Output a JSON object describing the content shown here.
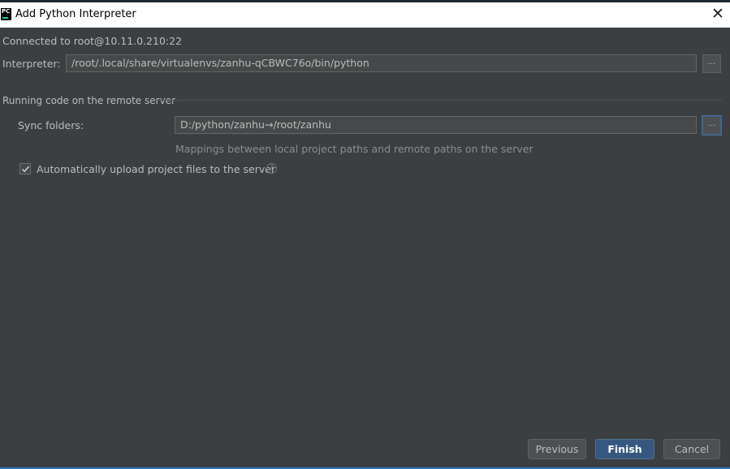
{
  "window": {
    "title": "Add Python Interpreter",
    "app_icon_text": "PC",
    "close_glyph": "✕"
  },
  "connection": {
    "text": "Connected to root@10.11.0.210:22"
  },
  "interpreter": {
    "label": "Interpreter:",
    "value": "/root/.local/share/virtualenvs/zanhu-qCBWC76o/bin/python",
    "browse_label": "..."
  },
  "remote_section": {
    "title": "Running code on the remote server"
  },
  "sync": {
    "label": "Sync folders:",
    "value": "D:/python/zanhu→/root/zanhu",
    "browse_label": "...",
    "hint": "Mappings between local project paths and remote paths on the server"
  },
  "auto_upload": {
    "label": "Automatically upload project files to the server",
    "checked": true,
    "help_glyph": "?"
  },
  "footer": {
    "previous": "Previous",
    "finish": "Finish",
    "cancel": "Cancel"
  },
  "colors": {
    "background": "#3c3f41",
    "primary_button": "#365880",
    "accent_strip": "#2b7ac9"
  },
  "icons": [
    "pycharm-logo-icon",
    "close-icon",
    "checkmark-icon",
    "help-icon"
  ]
}
